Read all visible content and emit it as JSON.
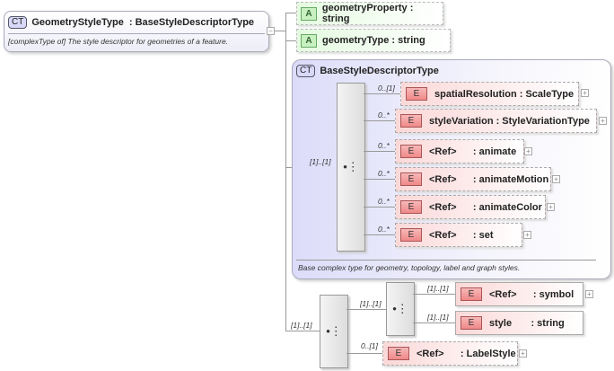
{
  "root": {
    "badge": "CT",
    "name": "GeometryStyleType",
    "type": ": BaseStyleDescriptorType",
    "description": "[complexType of] The style descriptor for geometries of a feature.",
    "collapse": "−"
  },
  "attributes": [
    {
      "badge": "A",
      "label": "geometryProperty : string"
    },
    {
      "badge": "A",
      "label": "geometryType : string"
    }
  ],
  "base": {
    "badge": "CT",
    "name": "BaseStyleDescriptorType",
    "description": "Base complex type for geometry, topology, label and graph styles.",
    "sequence_cardinality": "[1]..[1]",
    "elements": [
      {
        "card": "0..[1]",
        "badge": "E",
        "label": "spatialResolution : ScaleType"
      },
      {
        "card": "0..*",
        "badge": "E",
        "label": "styleVariation : StyleVariationType"
      },
      {
        "card": "0..*",
        "badge": "E",
        "label": "<Ref>      : animate"
      },
      {
        "card": "0..*",
        "badge": "E",
        "label": "<Ref>      : animateMotion"
      },
      {
        "card": "0..*",
        "badge": "E",
        "label": "<Ref>      : animateColor"
      },
      {
        "card": "0..*",
        "badge": "E",
        "label": "<Ref>      : set"
      }
    ]
  },
  "sequence2": {
    "card": "[1]..[1]",
    "inner_card": "[1]..[1]",
    "inner": [
      {
        "card": "[1]..[1]",
        "badge": "E",
        "label": "<Ref>      : symbol"
      },
      {
        "card": "[1]..[1]",
        "badge": "E",
        "label": "style       : string"
      }
    ],
    "label_style": {
      "card": "0..[1]",
      "badge": "E",
      "label": "<Ref>      : LabelStyle"
    }
  },
  "plus": "+"
}
